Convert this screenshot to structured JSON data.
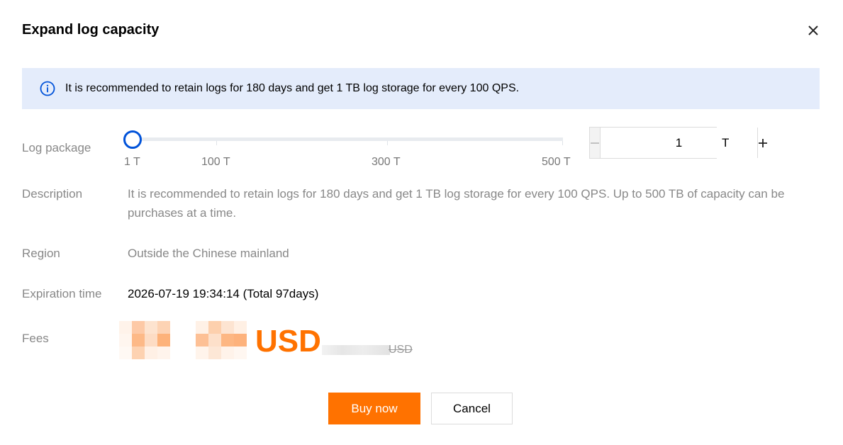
{
  "dialog": {
    "title": "Expand log capacity",
    "close_icon": "close-icon"
  },
  "notice": {
    "icon": "info-icon",
    "text": "It is recommended to retain logs for 180 days and get 1 TB log storage for every 100 QPS."
  },
  "log_package": {
    "label": "Log package",
    "slider": {
      "value": 1,
      "min": 1,
      "max": 500,
      "tick_labels": [
        "1 T",
        "100 T",
        "300 T",
        "500 T"
      ]
    },
    "stepper": {
      "value": "1",
      "minus_icon": "minus-icon",
      "plus_icon": "plus-icon"
    },
    "unit": "T"
  },
  "description": {
    "label": "Description",
    "value": "It is recommended to retain logs for 180 days and get 1 TB log storage for every 100 QPS. Up to 500 TB of capacity can be purchases at a time."
  },
  "region": {
    "label": "Region",
    "value": "Outside the Chinese mainland"
  },
  "expiration": {
    "label": "Expiration time",
    "value": "2026-07-19 19:34:14 (Total 97days)"
  },
  "fees": {
    "label": "Fees",
    "currency": "USD",
    "original_currency": "USD"
  },
  "actions": {
    "buy_label": "Buy now",
    "cancel_label": "Cancel"
  },
  "colors": {
    "accent": "#ff7200",
    "slider_thumb": "#0052d9",
    "notice_bg": "#e4ecfb"
  }
}
